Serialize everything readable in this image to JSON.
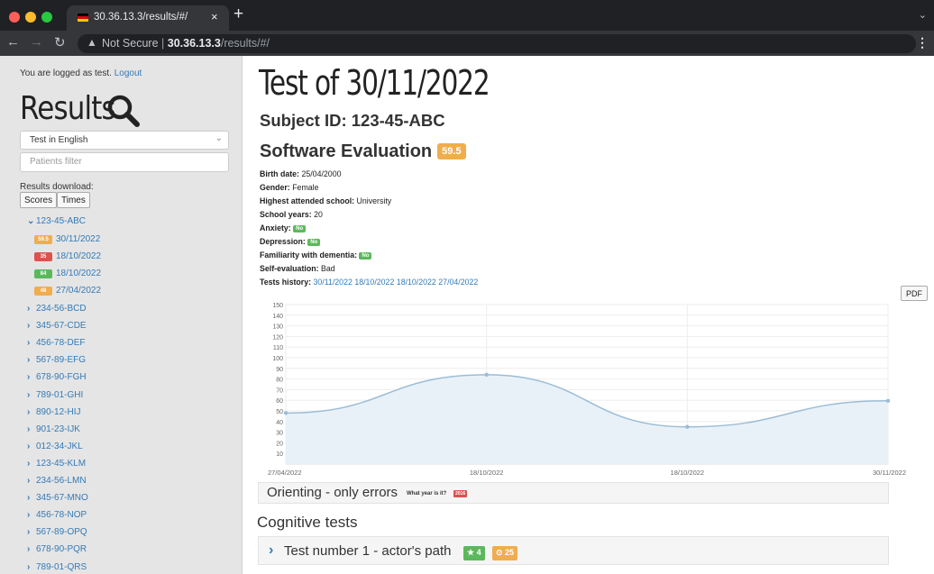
{
  "browser": {
    "tab_title": "30.36.13.3/results/#/",
    "tab_close": "×",
    "new_tab": "+",
    "not_secure": "Not Secure",
    "separator": "|",
    "url_host": "30.36.13.3",
    "url_path": "/results/#/"
  },
  "sidebar": {
    "logged_prefix": "You are logged as test.",
    "logout": "Logout",
    "title": "Results",
    "language": "Test in English",
    "filter_placeholder": "Patients filter",
    "download_label": "Results download:",
    "scores_button": "Scores",
    "times_button": "Times",
    "expanded_subject": "123-45-ABC",
    "tests": [
      {
        "score": "59.5",
        "date": "30/11/2022",
        "color": "#f0ad4e"
      },
      {
        "score": "35",
        "date": "18/10/2022",
        "color": "#d9534f"
      },
      {
        "score": "84",
        "date": "18/10/2022",
        "color": "#5cb85c"
      },
      {
        "score": "48",
        "date": "27/04/2022",
        "color": "#f0ad4e"
      }
    ],
    "subjects": [
      "234-56-BCD",
      "345-67-CDE",
      "456-78-DEF",
      "567-89-EFG",
      "678-90-FGH",
      "789-01-GHI",
      "890-12-HIJ",
      "901-23-IJK",
      "012-34-JKL",
      "123-45-KLM",
      "234-56-LMN",
      "345-67-MNO",
      "456-78-NOP",
      "567-89-OPQ",
      "678-90-PQR",
      "789-01-QRS"
    ]
  },
  "main": {
    "title": "Test of 30/11/2022",
    "subject_id": "Subject ID: 123-45-ABC",
    "evaluation": "Software Evaluation",
    "evaluation_score": "59.5",
    "info": {
      "birth_label": "Birth date:",
      "birth_value": "25/04/2000",
      "gender_label": "Gender:",
      "gender_value": "Female",
      "school_label": "Highest attended school:",
      "school_value": "University",
      "years_label": "School years:",
      "years_value": "20",
      "anxiety_label": "Anxiety:",
      "anxiety_value": "No",
      "depression_label": "Depression:",
      "depression_value": "No",
      "dementia_label": "Familiarity with dementia:",
      "dementia_value": "No",
      "self_label": "Self-evaluation:",
      "self_value": "Bad",
      "history_label": "Tests history:",
      "history": [
        "30/11/2022",
        "18/10/2022",
        "18/10/2022",
        "27/04/2022"
      ]
    },
    "pdf_button": "PDF",
    "orienting_title": "Orienting - only errors",
    "orienting_question": "What year is it?",
    "orienting_answer": "2016",
    "cognitive_title": "Cognitive tests",
    "test1_title": "Test number 1 - actor's path",
    "test1_stars": "★ 4",
    "test1_time": "⊙ 25",
    "test1_stars_color": "#5cb85c",
    "test1_time_color": "#f0ad4e"
  },
  "chart_data": {
    "type": "area",
    "categories": [
      "27/04/2022",
      "18/10/2022",
      "18/10/2022",
      "30/11/2022"
    ],
    "values": [
      48,
      84,
      35,
      59.5
    ],
    "y_ticks": [
      10,
      20,
      30,
      40,
      50,
      60,
      70,
      80,
      90,
      100,
      110,
      120,
      130,
      140,
      150
    ],
    "ylim": [
      0,
      150
    ],
    "grid": true,
    "line_color": "#9bbdd6",
    "fill_color": "#e9f1f8"
  }
}
